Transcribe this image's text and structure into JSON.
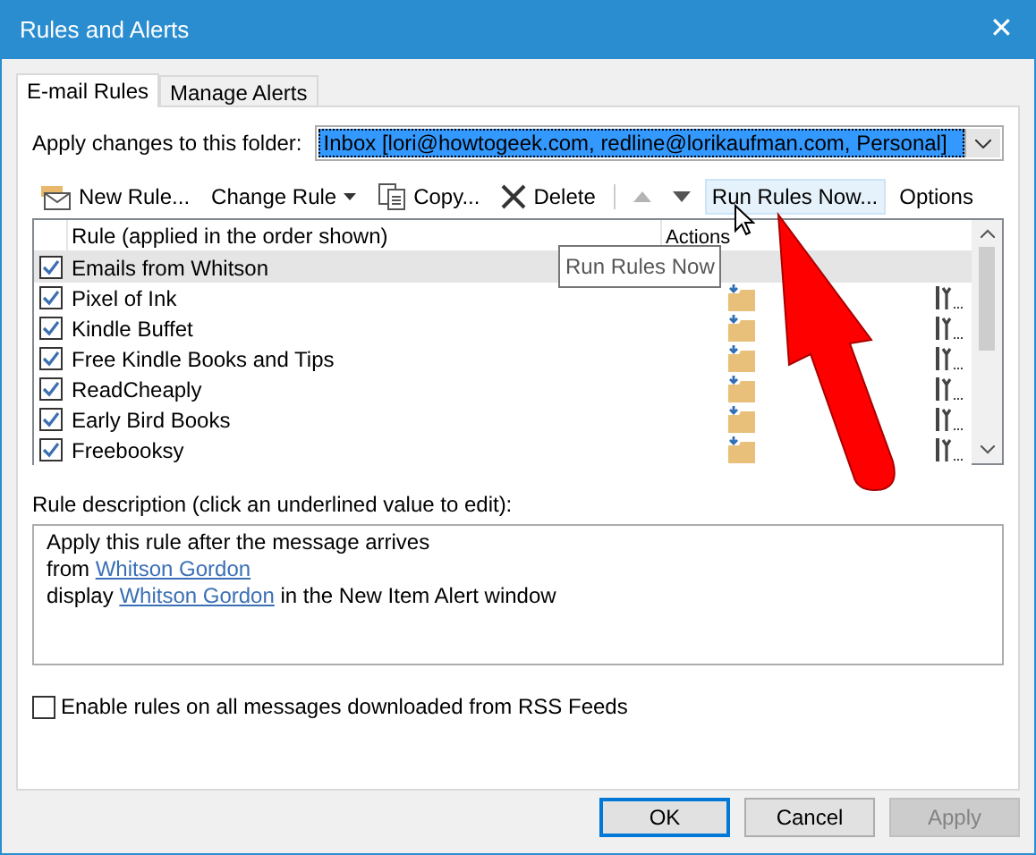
{
  "window": {
    "title": "Rules and Alerts",
    "close": "✕"
  },
  "tabs": [
    {
      "label": "E-mail Rules",
      "selected": true
    },
    {
      "label": "Manage Alerts",
      "selected": false
    }
  ],
  "folder": {
    "label": "Apply changes to this folder:",
    "value": "Inbox [lori@howtogeek.com, redline@lorikaufman.com, Personal]"
  },
  "toolbar": [
    {
      "kind": "new",
      "label": "New Rule..."
    },
    {
      "kind": "menu",
      "label": "Change Rule"
    },
    {
      "kind": "copy",
      "label": "Copy..."
    },
    {
      "kind": "delete",
      "label": "Delete"
    },
    {
      "kind": "up",
      "disabled": true
    },
    {
      "kind": "down",
      "disabled": false
    },
    {
      "kind": "hover",
      "label": "Run Rules Now..."
    },
    {
      "kind": "plain",
      "label": "Options"
    }
  ],
  "table": {
    "columns": [
      "Rule (applied in the order shown)",
      "Actions"
    ],
    "rows": [
      {
        "name": "Emails from Whitson",
        "checked": true,
        "selected": true
      },
      {
        "name": "Pixel of Ink",
        "checked": true,
        "selected": false
      },
      {
        "name": "Kindle Buffet",
        "checked": true,
        "selected": false
      },
      {
        "name": "Free Kindle Books and Tips",
        "checked": true,
        "selected": false
      },
      {
        "name": "ReadCheaply",
        "checked": true,
        "selected": false
      },
      {
        "name": "Early Bird Books",
        "checked": true,
        "selected": false
      },
      {
        "name": "Freebooksy",
        "checked": true,
        "selected": false
      }
    ]
  },
  "tooltip": "Run Rules Now",
  "description": {
    "label": "Rule description (click an underlined value to edit):",
    "lines": [
      [
        {
          "text": "Apply this rule after the message arrives"
        }
      ],
      [
        {
          "text": "from "
        },
        {
          "text": "Whitson Gordon",
          "link": true
        }
      ],
      [
        {
          "text": "display "
        },
        {
          "text": "Whitson Gordon",
          "link": true
        },
        {
          "text": " in the New Item Alert window"
        }
      ]
    ]
  },
  "rss": {
    "label": "Enable rules on all messages downloaded from RSS Feeds",
    "checked": false
  },
  "buttons": [
    {
      "label": "OK",
      "default": true,
      "disabled": false
    },
    {
      "label": "Cancel",
      "default": false,
      "disabled": false
    },
    {
      "label": "Apply",
      "default": false,
      "disabled": true
    }
  ]
}
